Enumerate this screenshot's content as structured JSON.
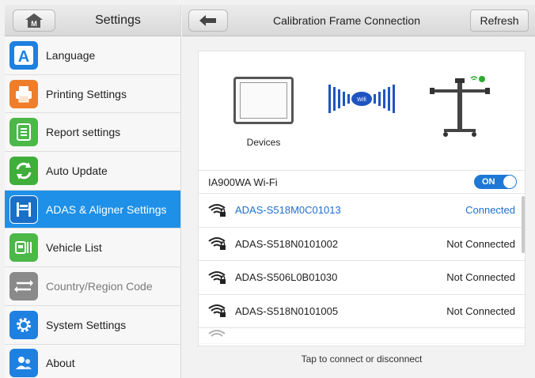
{
  "left_panel": {
    "title": "Settings",
    "home_badge": "M",
    "items": [
      {
        "label": "Language",
        "icon": "language-icon",
        "color": "#1e80e0",
        "state": "normal"
      },
      {
        "label": "Printing Settings",
        "icon": "printer-icon",
        "color": "#f07d2a",
        "state": "normal"
      },
      {
        "label": "Report settings",
        "icon": "report-icon",
        "color": "#4cb848",
        "state": "normal"
      },
      {
        "label": "Auto Update",
        "icon": "update-icon",
        "color": "#3fae3a",
        "state": "normal"
      },
      {
        "label": "ADAS & Aligner Settings",
        "icon": "adas-icon",
        "color": "#1a6fc8",
        "state": "active"
      },
      {
        "label": "Vehicle List",
        "icon": "vehicle-list-icon",
        "color": "#4cb848",
        "state": "normal"
      },
      {
        "label": "Country/Region Code",
        "icon": "region-icon",
        "color": "#8a8a8a",
        "state": "disabled"
      },
      {
        "label": "System Settings",
        "icon": "gear-icon",
        "color": "#1e80e0",
        "state": "normal"
      },
      {
        "label": "About",
        "icon": "about-icon",
        "color": "#1e80e0",
        "state": "normal"
      }
    ]
  },
  "right_panel": {
    "title": "Calibration Frame Connection",
    "refresh_label": "Refresh",
    "devices_label": "Devices",
    "wifi_badge": "Wifi",
    "wifi_name": "IA900WA Wi-Fi",
    "toggle_label": "ON",
    "networks": [
      {
        "name": "ADAS-S518M0C01013",
        "status": "Connected",
        "connected": true
      },
      {
        "name": "ADAS-S518N0101002",
        "status": "Not Connected",
        "connected": false
      },
      {
        "name": "ADAS-S506L0B01030",
        "status": "Not Connected",
        "connected": false
      },
      {
        "name": "ADAS-S518N0101005",
        "status": "Not Connected",
        "connected": false
      }
    ],
    "hint": "Tap to connect or disconnect"
  },
  "colors": {
    "accent": "#1e90e8",
    "connected": "#1e6fd0",
    "toggle_on": "#1e78d6"
  }
}
